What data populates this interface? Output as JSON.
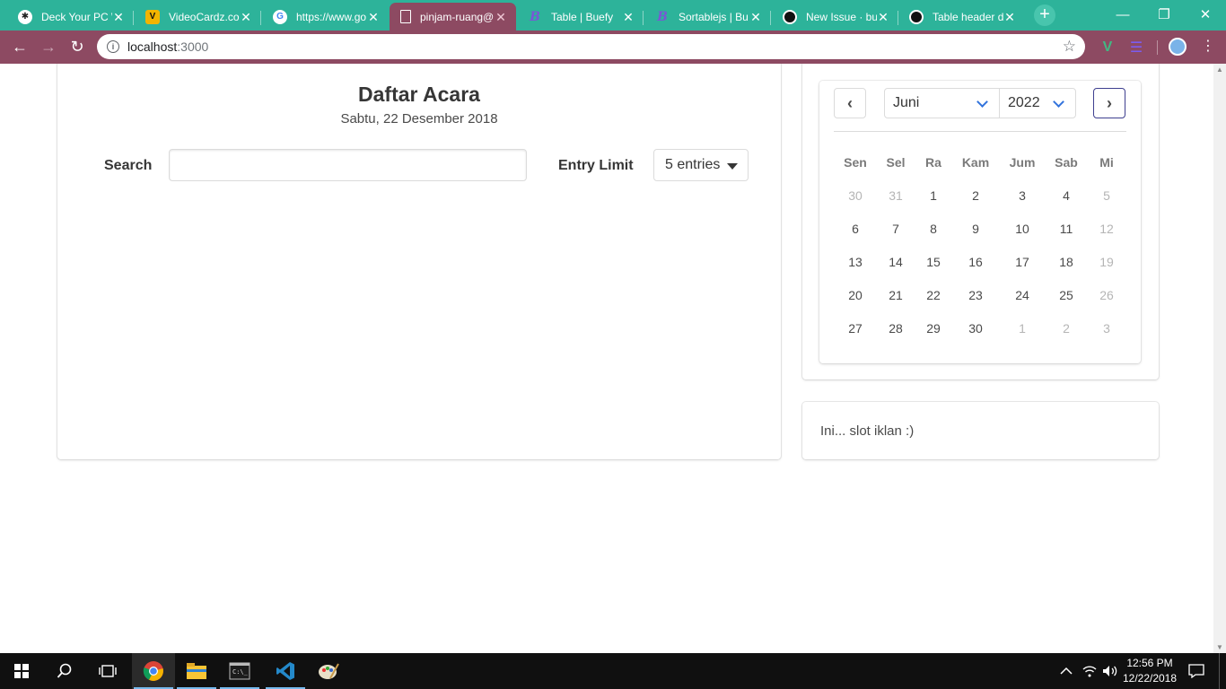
{
  "browser": {
    "tabs": [
      {
        "title": "Deck Your PC \\",
        "favicon": "deck-icon"
      },
      {
        "title": "VideoCardz.co",
        "favicon": "videocardz-icon"
      },
      {
        "title": "https://www.go",
        "favicon": "google-icon"
      },
      {
        "title": "pinjam-ruang@",
        "favicon": "page-icon"
      },
      {
        "title": "Table | Buefy",
        "favicon": "buefy-icon"
      },
      {
        "title": "Sortablejs | Bu",
        "favicon": "buefy-icon"
      },
      {
        "title": "New Issue · bu",
        "favicon": "github-icon"
      },
      {
        "title": "Table header d",
        "favicon": "github-icon"
      }
    ],
    "url_host": "localhost",
    "url_port": ":3000",
    "colors": {
      "tabstrip": "#2db39a",
      "active_frame": "#8d4a62"
    }
  },
  "page": {
    "title": "Daftar Acara",
    "subtitle": "Sabtu, 22 Desember 2018",
    "search_label": "Search",
    "search_value": "",
    "entry_label": "Entry Limit",
    "entry_value": "5 entries"
  },
  "calendar": {
    "month": "Juni",
    "year": "2022",
    "weekdays": [
      "Sen",
      "Sel",
      "Ra",
      "Kam",
      "Jum",
      "Sab",
      "Mi"
    ],
    "weeks": [
      [
        {
          "d": "30",
          "m": true
        },
        {
          "d": "31",
          "m": true
        },
        {
          "d": "1"
        },
        {
          "d": "2"
        },
        {
          "d": "3"
        },
        {
          "d": "4"
        },
        {
          "d": "5",
          "m": true
        }
      ],
      [
        {
          "d": "6"
        },
        {
          "d": "7"
        },
        {
          "d": "8"
        },
        {
          "d": "9"
        },
        {
          "d": "10"
        },
        {
          "d": "11"
        },
        {
          "d": "12",
          "m": true
        }
      ],
      [
        {
          "d": "13"
        },
        {
          "d": "14"
        },
        {
          "d": "15"
        },
        {
          "d": "16"
        },
        {
          "d": "17"
        },
        {
          "d": "18"
        },
        {
          "d": "19",
          "m": true
        }
      ],
      [
        {
          "d": "20"
        },
        {
          "d": "21"
        },
        {
          "d": "22"
        },
        {
          "d": "23"
        },
        {
          "d": "24"
        },
        {
          "d": "25"
        },
        {
          "d": "26",
          "m": true
        }
      ],
      [
        {
          "d": "27"
        },
        {
          "d": "28"
        },
        {
          "d": "29"
        },
        {
          "d": "30"
        },
        {
          "d": "1",
          "m": true
        },
        {
          "d": "2",
          "m": true
        },
        {
          "d": "3",
          "m": true
        }
      ]
    ]
  },
  "ad": {
    "text": "Ini... slot iklan :)"
  },
  "taskbar": {
    "time": "12:56 PM",
    "date": "12/22/2018"
  }
}
